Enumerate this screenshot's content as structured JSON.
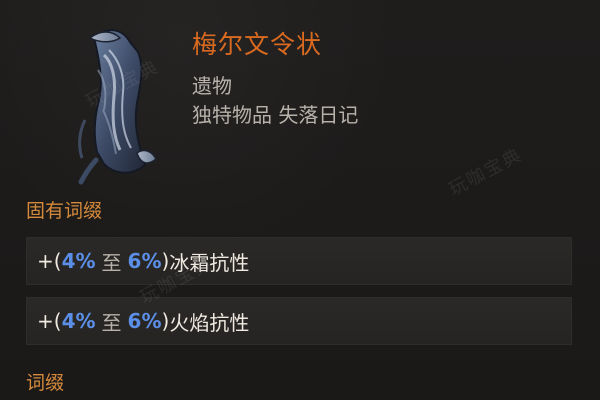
{
  "item": {
    "name": "梅尔文令状",
    "type": "遗物",
    "subtype": "独特物品 失落日记"
  },
  "sections": {
    "implicit_heading": "固有词缀",
    "explicit_heading": "词缀"
  },
  "affixes": [
    {
      "plus": "+",
      "open": "(",
      "min": "4%",
      "to": "至",
      "max": "6%",
      "close": ")",
      "stat": "冰霜抗性"
    },
    {
      "plus": "+",
      "open": "(",
      "min": "4%",
      "to": "至",
      "max": "6%",
      "close": ")",
      "stat": "火焰抗性"
    }
  ],
  "watermark": "玩咖宝典",
  "colors": {
    "unique_name": "#d96a1f",
    "section_heading": "#d58a3b",
    "range_number": "#5b8ee6",
    "background": "#1d1b1a"
  },
  "icons": {
    "item_icon": "scroll-icon"
  }
}
